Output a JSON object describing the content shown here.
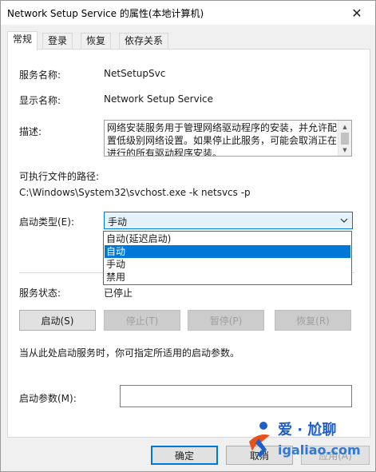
{
  "window": {
    "title": "Network Setup Service 的属性(本地计算机)",
    "close_glyph": "✕"
  },
  "tabs": [
    {
      "label": "常规",
      "active": true
    },
    {
      "label": "登录",
      "active": false
    },
    {
      "label": "恢复",
      "active": false
    },
    {
      "label": "依存关系",
      "active": false
    }
  ],
  "general": {
    "service_name_label": "服务名称:",
    "service_name_value": "NetSetupSvc",
    "display_name_label": "显示名称:",
    "display_name_value": "Network Setup Service",
    "description_label": "描述:",
    "description_value": "网络安装服务用于管理网络驱动程序的安装，并允许配置低级别网络设置。如果停止此服务，可能会取消正在进行的所有驱动程序安装。",
    "exe_path_label": "可执行文件的路径:",
    "exe_path_value": "C:\\Windows\\System32\\svchost.exe -k netsvcs -p",
    "startup_type_label": "启动类型(E):",
    "startup_type_value": "手动",
    "startup_type_options": [
      "自动(延迟启动)",
      "自动",
      "手动",
      "禁用"
    ],
    "startup_type_highlighted": "自动",
    "status_label": "服务状态:",
    "status_value": "已停止",
    "hint_text": "当从此处启动服务时，你可指定所适用的启动参数。",
    "params_label": "启动参数(M):",
    "params_value": ""
  },
  "service_buttons": {
    "start": "启动(S)",
    "stop": "停止(T)",
    "pause": "暂停(P)",
    "resume": "恢复(R)"
  },
  "dialog_buttons": {
    "ok": "确定",
    "cancel": "取消",
    "apply": "应用(A)"
  },
  "watermark": {
    "line1": "爱 · 尬聊",
    "line2": "igaliao.com"
  },
  "colors": {
    "accent": "#0078d7",
    "panel_bg": "#ffffff",
    "window_bg": "#f0f0f0"
  }
}
